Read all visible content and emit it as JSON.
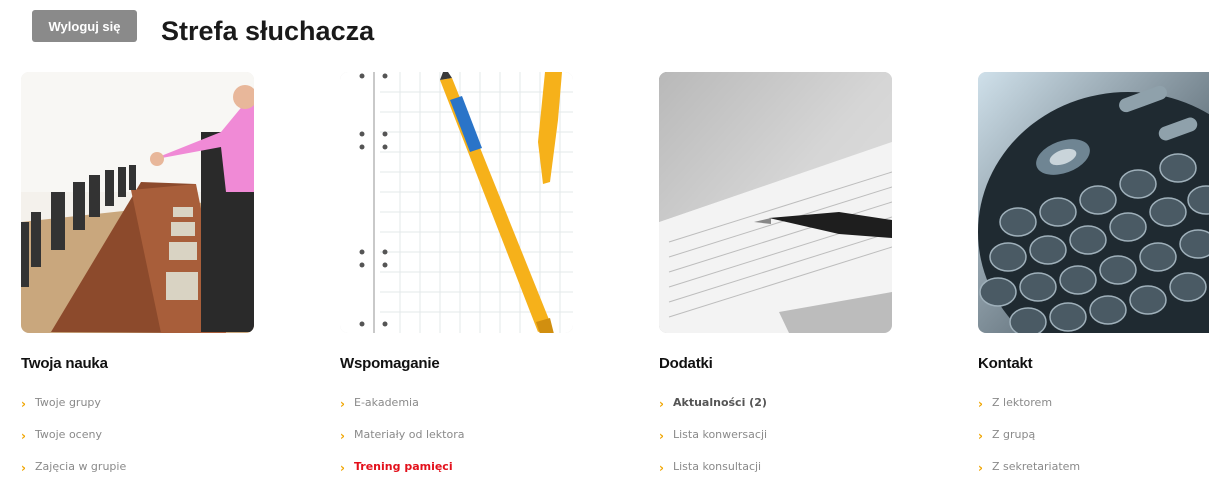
{
  "header": {
    "logout_label": "Wyloguj się",
    "title": "Strefa słuchacza"
  },
  "columns": [
    {
      "title": "Twoja nauka",
      "image": "classroom-photo",
      "links": [
        "Twoje grupy",
        "Twoje oceny",
        "Zajęcia w grupie"
      ]
    },
    {
      "title": "Wspomaganie",
      "image": "notebook-pen-photo",
      "links": [
        "E-akademia",
        "Materiały od lektora",
        "Trening pamięci"
      ]
    },
    {
      "title": "Dodatki",
      "image": "document-pen-photo",
      "links": [
        "Aktualności (2)",
        "Lista konwersacji",
        "Lista konsultacji"
      ]
    },
    {
      "title": "Kontakt",
      "image": "phone-keypad-photo",
      "links": [
        "Z lektorem",
        "Z grupą",
        "Z sekretariatem"
      ]
    }
  ],
  "colors": {
    "chevron": "#f0a500",
    "link": "#8a8a8a",
    "active_link": "#e3101b",
    "logout_bg": "#8a8a8a"
  }
}
